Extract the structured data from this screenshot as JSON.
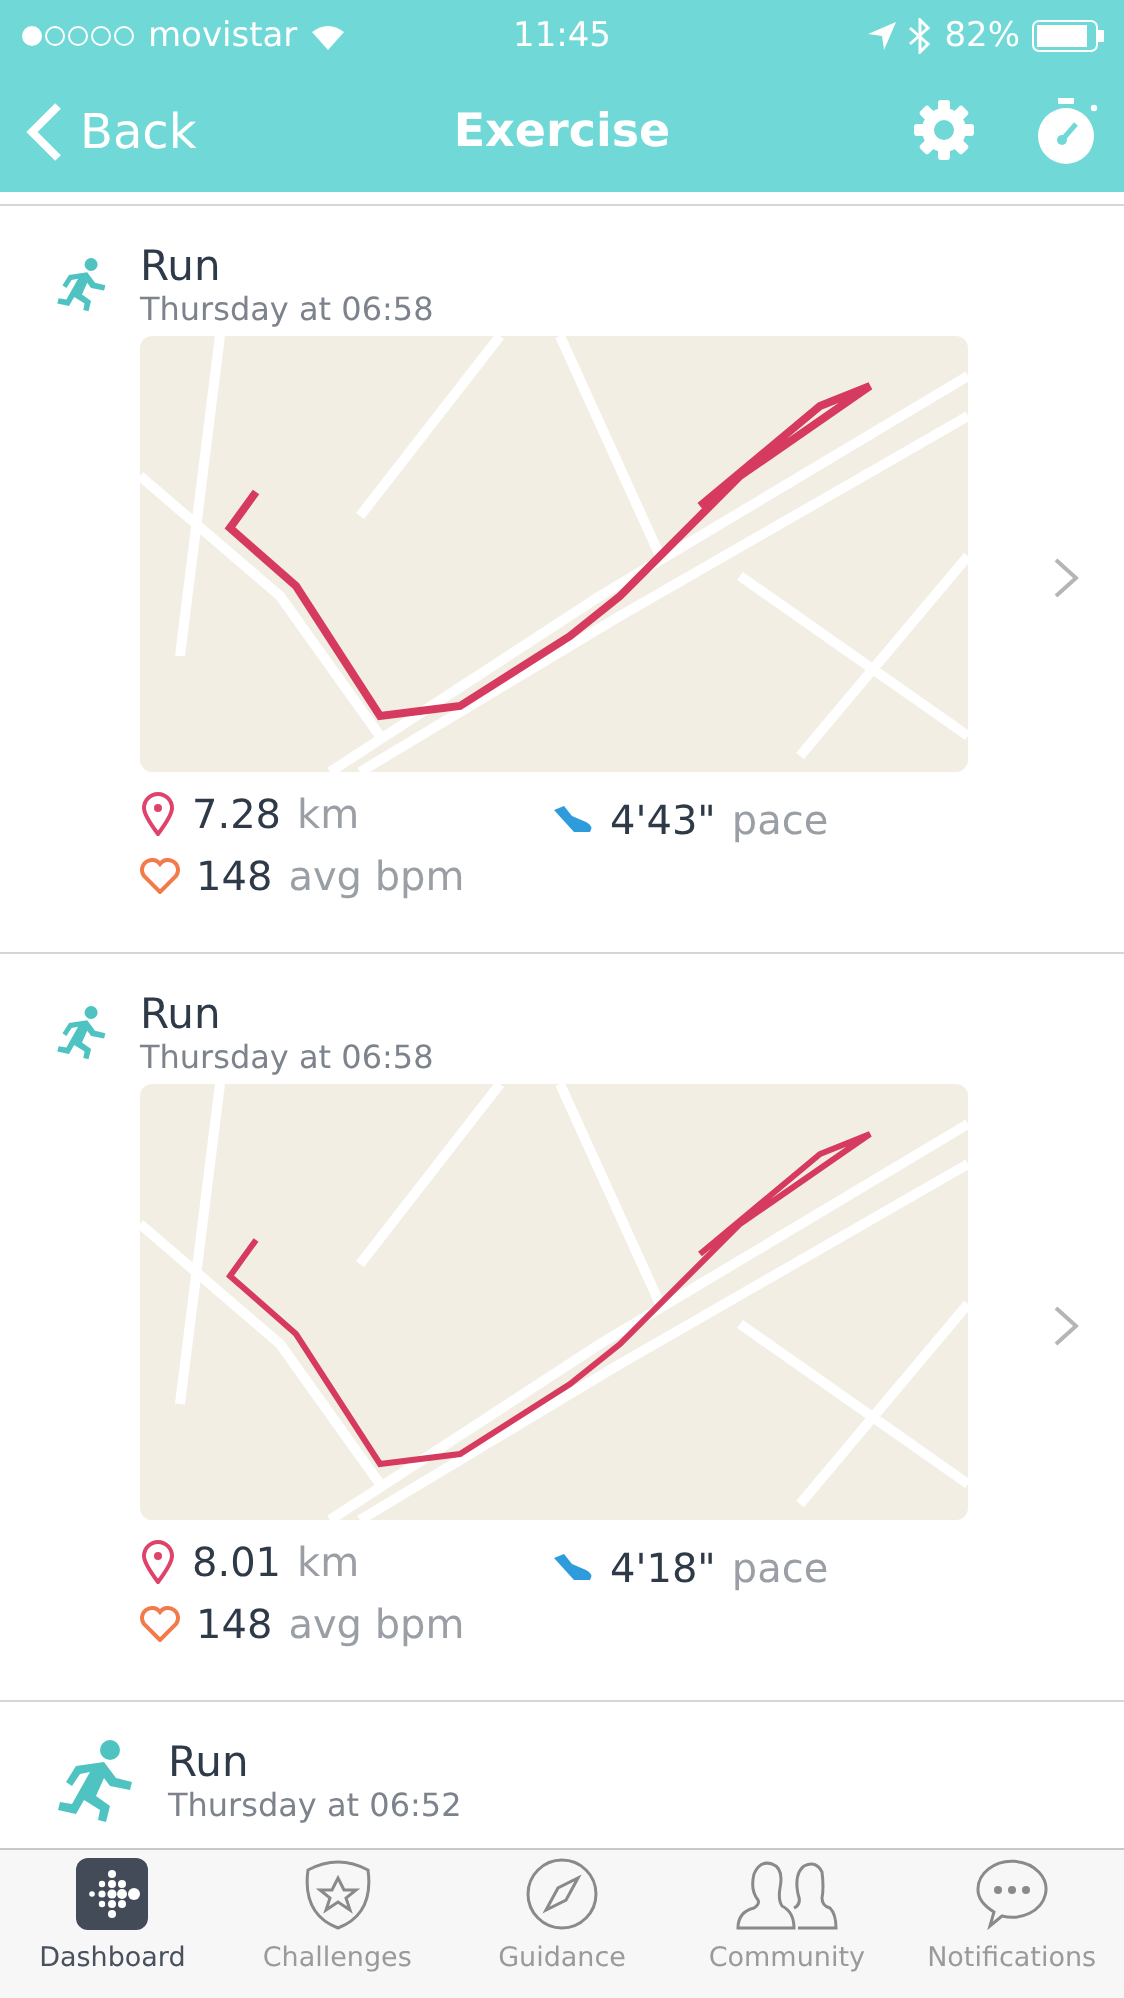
{
  "status_bar": {
    "carrier": "movistar",
    "time": "11:45",
    "battery": "82%"
  },
  "nav": {
    "back": "Back",
    "title": "Exercise"
  },
  "activities": [
    {
      "name": "Run",
      "time": "Thursday at 06:58",
      "distance": "7.28",
      "distance_unit": "km",
      "pace": "4'43\"",
      "pace_unit": "pace",
      "heart_rate": "148",
      "heart_rate_unit": "avg bpm"
    },
    {
      "name": "Run",
      "time": "Thursday at 06:58",
      "distance": "8.01",
      "distance_unit": "km",
      "pace": "4'18\"",
      "pace_unit": "pace",
      "heart_rate": "148",
      "heart_rate_unit": "avg bpm"
    },
    {
      "name": "Run",
      "time": "Thursday at 06:52"
    }
  ],
  "tab_bar": [
    {
      "label": "Dashboard",
      "kind": "dashboard",
      "selected": true
    },
    {
      "label": "Challenges",
      "kind": "challenges",
      "selected": false
    },
    {
      "label": "Guidance",
      "kind": "guidance",
      "selected": false
    },
    {
      "label": "Community",
      "kind": "community",
      "selected": false
    },
    {
      "label": "Notifications",
      "kind": "notifications",
      "selected": false
    }
  ]
}
